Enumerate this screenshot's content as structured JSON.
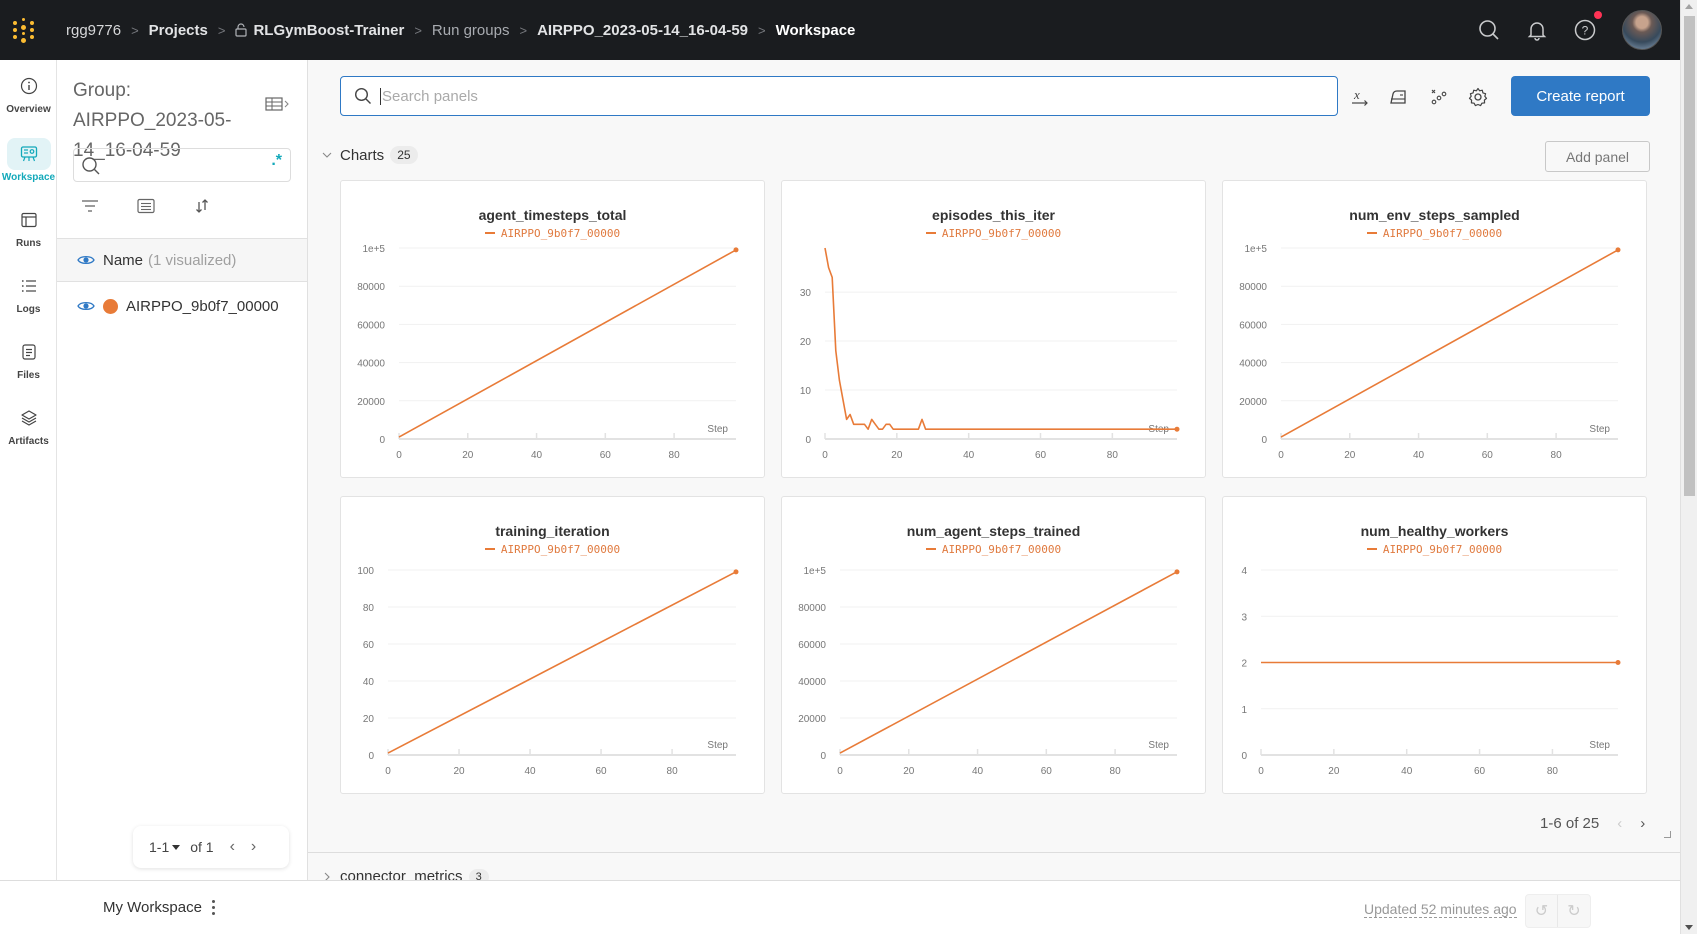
{
  "topbar": {
    "breadcrumbs": [
      "rgg9776",
      "Projects",
      "RLGymBoost-Trainer",
      "Run groups",
      "AIRPPO_2023-05-14_16-04-59",
      "Workspace"
    ],
    "icons": [
      "search-icon",
      "bell-icon",
      "help-icon",
      "avatar"
    ]
  },
  "rail": {
    "items": [
      {
        "label": "Overview",
        "icon": "info-icon"
      },
      {
        "label": "Workspace",
        "icon": "workspace-icon",
        "active": true
      },
      {
        "label": "Runs",
        "icon": "table-icon"
      },
      {
        "label": "Logs",
        "icon": "list-icon"
      },
      {
        "label": "Files",
        "icon": "file-icon"
      },
      {
        "label": "Artifacts",
        "icon": "layers-icon"
      }
    ]
  },
  "runs_panel": {
    "group_title": "Group: AIRPPO_2023-05-14_16-04-59",
    "search_placeholder": "",
    "regex_label": ".*",
    "header_name": "Name",
    "header_sub": "(1 visualized)",
    "runs": [
      {
        "name": "AIRPPO_9b0f7_00000",
        "color": "#e87b38"
      }
    ],
    "pager": {
      "range": "1-1",
      "of": "of 1"
    }
  },
  "main": {
    "search_placeholder": "Search panels",
    "create_report_label": "Create report",
    "section_title": "Charts",
    "section_count": "25",
    "add_panel_label": "Add panel",
    "pager_text": "1-6 of 25",
    "next_section_title": "connector_metrics",
    "next_section_count": "3"
  },
  "footer": {
    "workspace_name": "My Workspace",
    "updated": "Updated 52 minutes ago"
  },
  "chart_data": [
    {
      "type": "line",
      "title": "agent_timesteps_total",
      "legend": [
        "AIRPPO_9b0f7_00000"
      ],
      "xlabel": "Step",
      "xlim": [
        0,
        98
      ],
      "ylim": [
        0,
        100000
      ],
      "xticks": [
        "0",
        "20",
        "40",
        "60",
        "80"
      ],
      "xtick_values": [
        0,
        20,
        40,
        60,
        80
      ],
      "yticks": [
        "0",
        "20000",
        "40000",
        "60000",
        "80000",
        "1e+5"
      ],
      "ytick_values": [
        0,
        20000,
        40000,
        60000,
        80000,
        100000
      ],
      "series": [
        {
          "name": "AIRPPO_9b0f7_00000",
          "color": "#e87b38",
          "x": [
            0,
            98
          ],
          "y": [
            1000,
            99000
          ]
        }
      ]
    },
    {
      "type": "line",
      "title": "episodes_this_iter",
      "legend": [
        "AIRPPO_9b0f7_00000"
      ],
      "xlabel": "Step",
      "xlim": [
        0,
        98
      ],
      "ylim": [
        0,
        39
      ],
      "xticks": [
        "0",
        "20",
        "40",
        "60",
        "80"
      ],
      "xtick_values": [
        0,
        20,
        40,
        60,
        80
      ],
      "yticks": [
        "0",
        "10",
        "20",
        "30"
      ],
      "ytick_values": [
        0,
        10,
        20,
        30
      ],
      "series": [
        {
          "name": "AIRPPO_9b0f7_00000",
          "color": "#e87b38",
          "x": [
            0,
            1,
            2,
            3,
            4,
            5,
            6,
            7,
            8,
            9,
            10,
            11,
            12,
            13,
            14,
            15,
            16,
            17,
            18,
            19,
            20,
            25,
            26,
            27,
            28,
            40,
            60,
            80,
            98
          ],
          "y": [
            39,
            35,
            33,
            18,
            12,
            8,
            4,
            5,
            3,
            3,
            3,
            3,
            2,
            4,
            3,
            2,
            2,
            3,
            3,
            2,
            2,
            2,
            2,
            4,
            2,
            2,
            2,
            2,
            2
          ]
        }
      ]
    },
    {
      "type": "line",
      "title": "num_env_steps_sampled",
      "legend": [
        "AIRPPO_9b0f7_00000"
      ],
      "xlabel": "Step",
      "xlim": [
        0,
        98
      ],
      "ylim": [
        0,
        100000
      ],
      "xticks": [
        "0",
        "20",
        "40",
        "60",
        "80"
      ],
      "xtick_values": [
        0,
        20,
        40,
        60,
        80
      ],
      "yticks": [
        "0",
        "20000",
        "40000",
        "60000",
        "80000",
        "1e+5"
      ],
      "ytick_values": [
        0,
        20000,
        40000,
        60000,
        80000,
        100000
      ],
      "series": [
        {
          "name": "AIRPPO_9b0f7_00000",
          "color": "#e87b38",
          "x": [
            0,
            98
          ],
          "y": [
            1000,
            99000
          ]
        }
      ]
    },
    {
      "type": "line",
      "title": "training_iteration",
      "legend": [
        "AIRPPO_9b0f7_00000"
      ],
      "xlabel": "Step",
      "xlim": [
        0,
        98
      ],
      "ylim": [
        0,
        100
      ],
      "xticks": [
        "0",
        "20",
        "40",
        "60",
        "80"
      ],
      "xtick_values": [
        0,
        20,
        40,
        60,
        80
      ],
      "yticks": [
        "0",
        "20",
        "40",
        "60",
        "80",
        "100"
      ],
      "ytick_values": [
        0,
        20,
        40,
        60,
        80,
        100
      ],
      "series": [
        {
          "name": "AIRPPO_9b0f7_00000",
          "color": "#e87b38",
          "x": [
            0,
            98
          ],
          "y": [
            1,
            99
          ]
        }
      ]
    },
    {
      "type": "line",
      "title": "num_agent_steps_trained",
      "legend": [
        "AIRPPO_9b0f7_00000"
      ],
      "xlabel": "Step",
      "xlim": [
        0,
        98
      ],
      "ylim": [
        0,
        100000
      ],
      "xticks": [
        "0",
        "20",
        "40",
        "60",
        "80"
      ],
      "xtick_values": [
        0,
        20,
        40,
        60,
        80
      ],
      "yticks": [
        "0",
        "20000",
        "40000",
        "60000",
        "80000",
        "1e+5"
      ],
      "ytick_values": [
        0,
        20000,
        40000,
        60000,
        80000,
        100000
      ],
      "series": [
        {
          "name": "AIRPPO_9b0f7_00000",
          "color": "#e87b38",
          "x": [
            0,
            98
          ],
          "y": [
            1000,
            99000
          ]
        }
      ]
    },
    {
      "type": "line",
      "title": "num_healthy_workers",
      "legend": [
        "AIRPPO_9b0f7_00000"
      ],
      "xlabel": "Step",
      "xlim": [
        0,
        98
      ],
      "ylim": [
        0,
        4
      ],
      "xticks": [
        "0",
        "20",
        "40",
        "60",
        "80"
      ],
      "xtick_values": [
        0,
        20,
        40,
        60,
        80
      ],
      "yticks": [
        "0",
        "1",
        "2",
        "3",
        "4"
      ],
      "ytick_values": [
        0,
        1,
        2,
        3,
        4
      ],
      "series": [
        {
          "name": "AIRPPO_9b0f7_00000",
          "color": "#e87b38",
          "x": [
            0,
            98
          ],
          "y": [
            2,
            2
          ]
        }
      ]
    }
  ]
}
